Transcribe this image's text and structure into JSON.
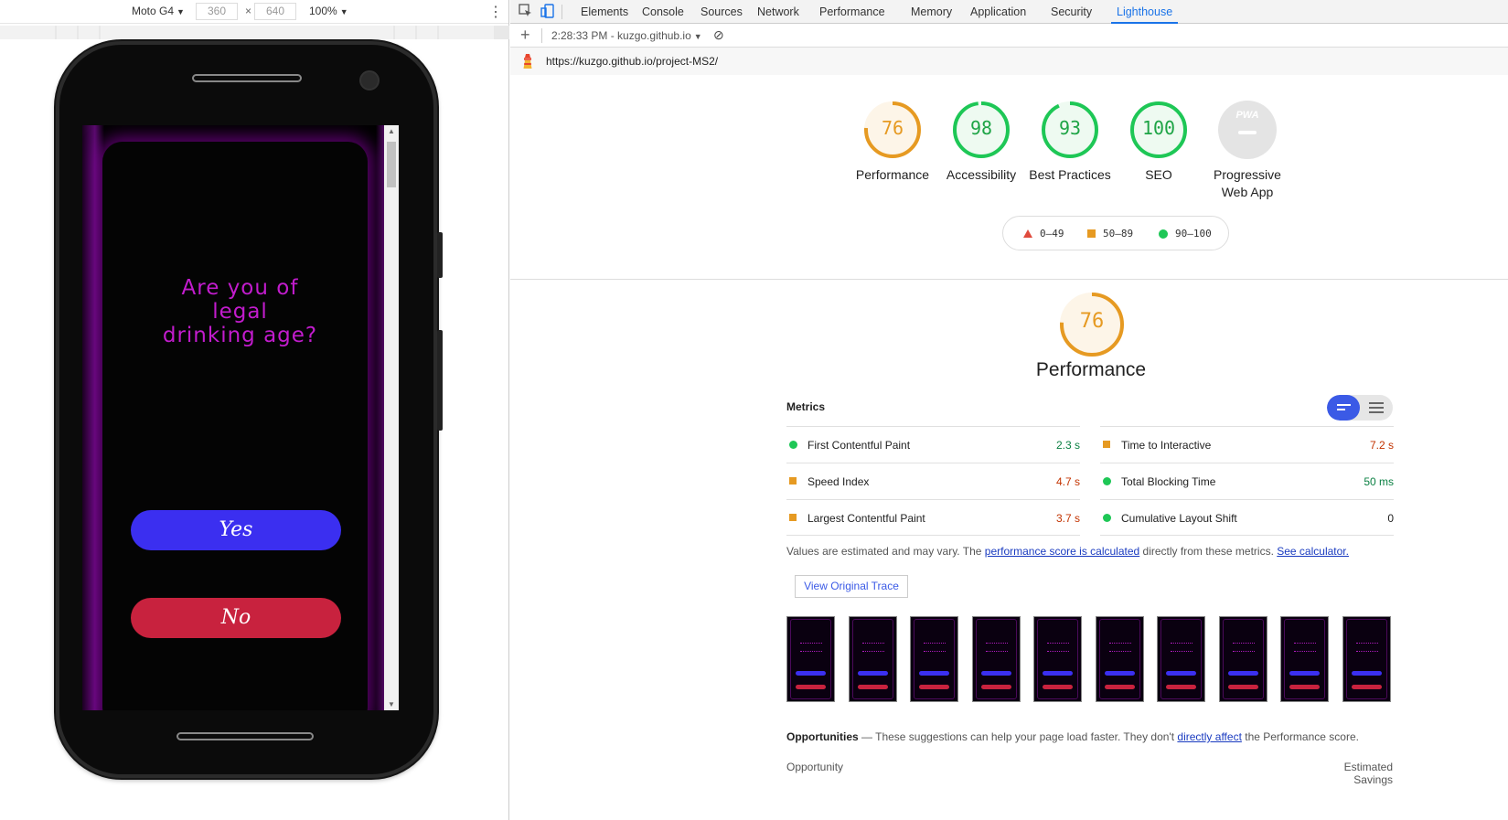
{
  "device_toolbar": {
    "device": "Moto G4",
    "width": "360",
    "height": "640",
    "times": "×",
    "zoom": "100%"
  },
  "app": {
    "prompt_line1": "Are you of",
    "prompt_line2": "legal",
    "prompt_line3": "drinking age?",
    "yes_label": "Yes",
    "no_label": "No",
    "colors": {
      "prompt": "#c21ccd",
      "yes": "#3b2ff0",
      "no": "#c8223e"
    }
  },
  "devtools": {
    "tabs": [
      "Elements",
      "Console",
      "Sources",
      "Network",
      "Performance",
      "Memory",
      "Application",
      "Security",
      "Lighthouse"
    ],
    "active_tab": "Lighthouse",
    "report_label": "2:28:33 PM - kuzgo.github.io",
    "url": "https://kuzgo.github.io/project-MS2/"
  },
  "gauges": [
    {
      "score": "76",
      "label": "Performance",
      "color": "#e69a22"
    },
    {
      "score": "98",
      "label": "Accessibility",
      "color": "#1ec756"
    },
    {
      "score": "93",
      "label": "Best Practices",
      "color": "#1ec756"
    },
    {
      "score": "100",
      "label": "SEO",
      "color": "#1ec756"
    }
  ],
  "pwa": {
    "badge": "PWA",
    "label": "Progressive Web App"
  },
  "legend": {
    "fail": "0–49",
    "average": "50–89",
    "pass": "90–100"
  },
  "performance": {
    "score": "76",
    "title": "Performance",
    "metrics_heading": "Metrics",
    "metrics_left": [
      {
        "name": "First Contentful Paint",
        "value": "2.3 s",
        "rating": "pass"
      },
      {
        "name": "Speed Index",
        "value": "4.7 s",
        "rating": "average"
      },
      {
        "name": "Largest Contentful Paint",
        "value": "3.7 s",
        "rating": "average"
      }
    ],
    "metrics_right": [
      {
        "name": "Time to Interactive",
        "value": "7.2 s",
        "rating": "average"
      },
      {
        "name": "Total Blocking Time",
        "value": "50 ms",
        "rating": "pass"
      },
      {
        "name": "Cumulative Layout Shift",
        "value": "0",
        "rating": "pass"
      }
    ],
    "note_prefix": "Values are estimated and may vary. The ",
    "note_link1": "performance score is calculated",
    "note_middle": " directly from these metrics. ",
    "note_link2": "See calculator.",
    "trace_button": "View Original Trace",
    "opportunities_title": "Opportunities",
    "opportunities_text": " — These suggestions can help your page load faster. They don't ",
    "opportunities_link": "directly affect",
    "opportunities_tail": " the Performance score.",
    "opportunity_col": "Opportunity",
    "savings_col": "Estimated Savings"
  }
}
